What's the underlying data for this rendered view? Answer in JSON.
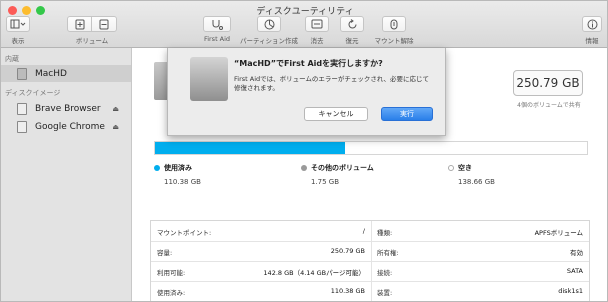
{
  "window": {
    "title": "ディスクユーティリティ",
    "lights": [
      "#fc5b57",
      "#fcbc2e",
      "#34c84a"
    ]
  },
  "toolbar": {
    "view_label": "表示",
    "volume_label": "ボリューム",
    "firstaid_label": "First Aid",
    "partition_label": "パーティション作成",
    "erase_label": "消去",
    "restore_label": "復元",
    "unmount_label": "マウント解除",
    "info_label": "情報"
  },
  "sidebar": {
    "internal_header": "内蔵",
    "internal_items": [
      {
        "label": "MacHD"
      }
    ],
    "image_header": "ディスクイメージ",
    "image_items": [
      {
        "label": "Brave Browser"
      },
      {
        "label": "Google Chrome"
      }
    ],
    "eject_glyph": "⏏"
  },
  "main": {
    "capacity": "250.79 GB",
    "capacity_sub": "4個のボリュームで共有",
    "usage": {
      "used_fraction": 0.44
    },
    "legend": [
      {
        "name": "使用済み",
        "value": "110.38 GB",
        "color": "#00aeee"
      },
      {
        "name": "その他のボリューム",
        "value": "1.75 GB",
        "color": "#9a9a9a"
      },
      {
        "name": "空き",
        "value": "138.66 GB",
        "color": "#ffffff"
      }
    ],
    "info_left": [
      {
        "k": "マウントポイント:",
        "v": "/"
      },
      {
        "k": "容量:",
        "v": "250.79 GB"
      },
      {
        "k": "利用可能:",
        "v": "142.8 GB（4.14 GBパージ可能）"
      },
      {
        "k": "使用済み:",
        "v": "110.38 GB"
      }
    ],
    "info_right": [
      {
        "k": "種類:",
        "v": "APFSボリューム"
      },
      {
        "k": "所有権:",
        "v": "有効"
      },
      {
        "k": "接続:",
        "v": "SATA"
      },
      {
        "k": "装置:",
        "v": "disk1s1"
      }
    ]
  },
  "dialog": {
    "title": "“MacHD”でFirst Aidを実行しますか?",
    "body": "First Aidでは、ボリュームのエラーがチェックされ、必要に応じて修復されます。",
    "cancel_label": "キャンセル",
    "run_label": "実行"
  }
}
